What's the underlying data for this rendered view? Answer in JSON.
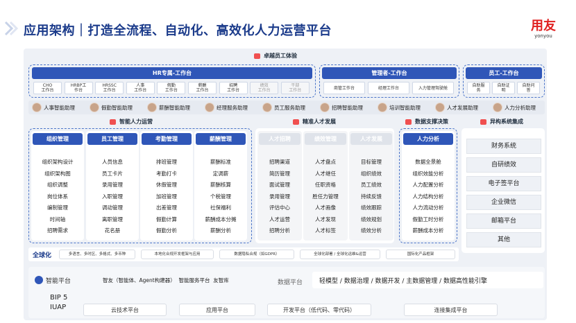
{
  "title": "应用架构｜打造全流程、自动化、高效化人力运营平台",
  "logo": {
    "cn": "用友",
    "en": "yonyou"
  },
  "experience_label": "卓越员工体验",
  "hr_desk": {
    "title": "HR专属-工作台",
    "items": [
      "CHO\n工作台",
      "HRBP工\n作台",
      "HRSSC\n工作台",
      "人事\n工作台",
      "假勤\n工作台",
      "薪酬\n工作台",
      "招聘\n工作台",
      "绩效\n工作台",
      "干部\n工作台"
    ]
  },
  "mgr_desk": {
    "title": "管理者-工作台",
    "items": [
      "商管工作台",
      "经理工作台",
      "入力管理驾驶舱"
    ]
  },
  "emp_desk": {
    "title": "员工-工作台",
    "items": [
      "自助服\n务",
      "自助证\n明",
      "自助问\n答"
    ]
  },
  "assistants": [
    "人事智能助理",
    "假勤智能助理",
    "薪酬智能助理",
    "经理服务助理",
    "员工服务助理",
    "招聘智能助理",
    "培训智能助理",
    "人才发展助理",
    "人力分析助理"
  ],
  "cat_labels": {
    "ops": "智能人力运营",
    "talent": "精准人才发展",
    "data": "数据支撑决策",
    "hetero": "异构系统集成"
  },
  "columns": [
    {
      "header": "组织管理",
      "items": [
        "组织架构设计",
        "组织架构图",
        "组织调整",
        "岗位体系",
        "编制管理",
        "时间轴",
        "招聘需求"
      ]
    },
    {
      "header": "员工管理",
      "items": [
        "人员信息",
        "员工卡片",
        "录用管理",
        "入职管理",
        "调动管理",
        "离职管理",
        "花名册"
      ]
    },
    {
      "header": "考勤管理",
      "items": [
        "排班管理",
        "考勤打卡",
        "休假管理",
        "加班管理",
        "出差管理",
        "假勤计算",
        "假勤分析"
      ]
    },
    {
      "header": "薪酬管理",
      "items": [
        "薪酬标准",
        "定调薪",
        "薪酬核算",
        "个税管理",
        "社保福利",
        "薪酬成本分摊",
        "薪酬分析"
      ]
    },
    {
      "header": "人才招聘",
      "items": [
        "招聘渠道",
        "简历管理",
        "面试管理",
        "录用管理",
        "评估中心",
        "人才运营",
        "招聘分析"
      ]
    },
    {
      "header": "绩效管理",
      "items": [
        "人才盘点",
        "人才继任",
        "任职资格",
        "胜任力管理",
        "人才画像",
        "人才发现",
        "人才标签"
      ]
    },
    {
      "header": "人才发展",
      "items": [
        "目标管理",
        "组织绩效",
        "员工绩效",
        "持续反馈",
        "绩效跟踪",
        "绩效规划",
        "绩效分析"
      ]
    },
    {
      "header": "人力分析",
      "items": [
        "数据全景舱",
        "组织效能分析",
        "人力配置分析",
        "人力结构分析",
        "人力流动分析",
        "假勤工时分析",
        "薪酬成本分析"
      ]
    }
  ],
  "hetero_items": [
    "财务系统",
    "自研绩效",
    "电子签平台",
    "企业微信",
    "邮箱平台",
    "其他"
  ],
  "global": {
    "label": "全球化",
    "items": [
      "多语言、多时区、多格式、多币种",
      "本地化合规开发框架与应用",
      "数据隐私合规（如GDPR）",
      "全球化部署 / 全球化运维&运营",
      "国际化产品框架"
    ]
  },
  "platform": {
    "ai_label": "智能平台",
    "ai_items": "智友（智能体、Agent构建器）  智能服务平台  友智库",
    "data_label": "数据平台",
    "data_items": "轻模型 / 数据治理 / 数据开发 / 主数据管理 / 数据高性能引擎",
    "bip_line1": "BIP 5",
    "bip_line2": "IUAP",
    "bottom": [
      "云技术平台",
      "应用平台",
      "开发平台（低代码、零代码）",
      "连接集成平台"
    ]
  },
  "colors": {
    "primary": "#2f56b8",
    "title": "#1a3a8a",
    "accent": "#e02020"
  }
}
